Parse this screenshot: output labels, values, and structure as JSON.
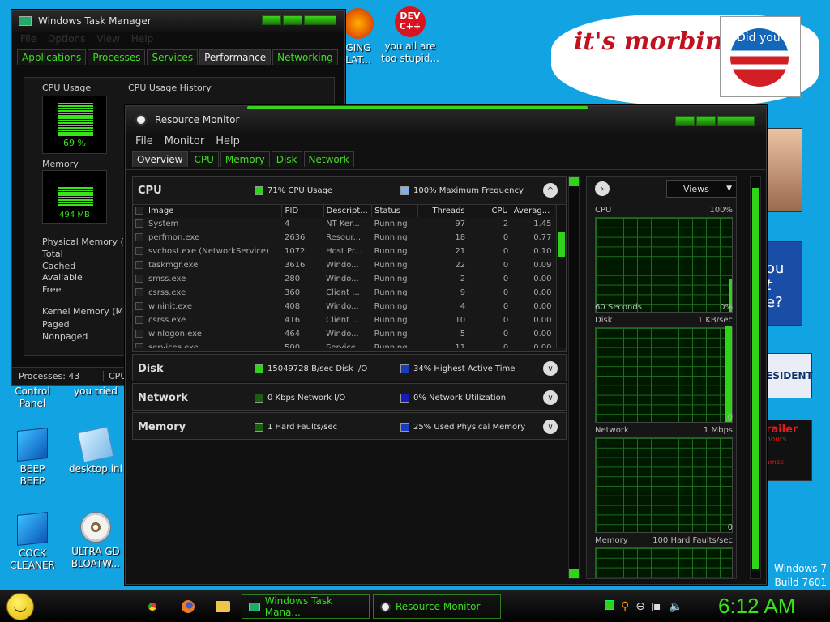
{
  "desktop": {
    "icons": [
      {
        "label": "GING\nLAT...",
        "icon": "folder-icon"
      },
      {
        "label": "you all are\ntoo stupid...",
        "icon": "devcpp-icon"
      },
      {
        "label": "Control\nPanel",
        "icon": "control-panel-icon"
      },
      {
        "label": "you tried",
        "icon": "file-icon"
      },
      {
        "label": "BEEP\nBEEP",
        "icon": "blue-box-icon"
      },
      {
        "label": "desktop.ini",
        "icon": "settings-file-icon"
      },
      {
        "label": "COCK\nCLEANER",
        "icon": "blue-box-icon"
      },
      {
        "label": "ULTRA GD\nBLOATW...",
        "icon": "disc-icon"
      }
    ],
    "dev_badge": "DEV\nC++",
    "banner_text": "it's morbin t",
    "obama_text": "Did you",
    "side_texts": [
      "ou",
      "t",
      "e?",
      "ESIDENT",
      "railer",
      "hours",
      "ames"
    ],
    "watermark": [
      "Windows 7",
      "Build 7601"
    ]
  },
  "task_manager": {
    "title": "Windows Task Manager",
    "menu": [
      "File",
      "Options",
      "View",
      "Help"
    ],
    "tabs": [
      "Applications",
      "Processes",
      "Services",
      "Performance",
      "Networking"
    ],
    "cpu_usage_label": "CPU Usage",
    "cpu_value": "69 %",
    "cpu_history_label": "CPU Usage History",
    "memory_label": "Memory",
    "memory_value": "494 MB",
    "physical_memory_label": "Physical Memory (MB",
    "physical_rows": [
      "Total",
      "Cached",
      "Available",
      "Free"
    ],
    "kernel_label": "Kernel Memory (MB)",
    "kernel_rows": [
      "Paged",
      "Nonpaged"
    ],
    "status_processes": "Processes: 43",
    "status_cpu": "CPU"
  },
  "resource_monitor": {
    "title": "Resource Monitor",
    "menu": [
      "File",
      "Monitor",
      "Help"
    ],
    "tabs": [
      "Overview",
      "CPU",
      "Memory",
      "Disk",
      "Network"
    ],
    "cpu_section": {
      "name": "CPU",
      "metric1": "71% CPU Usage",
      "metric2": "100% Maximum Frequency",
      "columns": [
        "Image",
        "PID",
        "Descript...",
        "Status",
        "Threads",
        "CPU",
        "Averag..."
      ],
      "rows": [
        [
          "System",
          "4",
          "NT Ker...",
          "Running",
          "97",
          "2",
          "1.45"
        ],
        [
          "perfmon.exe",
          "2636",
          "Resour...",
          "Running",
          "18",
          "0",
          "0.77"
        ],
        [
          "svchost.exe (NetworkService)",
          "1072",
          "Host Pr...",
          "Running",
          "21",
          "0",
          "0.10"
        ],
        [
          "taskmgr.exe",
          "3616",
          "Windo...",
          "Running",
          "22",
          "0",
          "0.09"
        ],
        [
          "smss.exe",
          "280",
          "Windo...",
          "Running",
          "2",
          "0",
          "0.00"
        ],
        [
          "csrss.exe",
          "360",
          "Client ...",
          "Running",
          "9",
          "0",
          "0.00"
        ],
        [
          "wininit.exe",
          "408",
          "Windo...",
          "Running",
          "4",
          "0",
          "0.00"
        ],
        [
          "csrss.exe",
          "416",
          "Client ...",
          "Running",
          "10",
          "0",
          "0.00"
        ],
        [
          "winlogon.exe",
          "464",
          "Windo...",
          "Running",
          "5",
          "0",
          "0.00"
        ],
        [
          "services.exe",
          "500",
          "Service...",
          "Running",
          "11",
          "0",
          "0.00"
        ]
      ]
    },
    "disk_section": {
      "name": "Disk",
      "metric1": "15049728 B/sec Disk I/O",
      "metric2": "34% Highest Active Time"
    },
    "network_section": {
      "name": "Network",
      "metric1": "0 Kbps Network I/O",
      "metric2": "0% Network Utilization"
    },
    "memory_section": {
      "name": "Memory",
      "metric1": "1 Hard Faults/sec",
      "metric2": "25% Used Physical Memory"
    },
    "views_label": "Views",
    "graphs": [
      {
        "name": "CPU",
        "max": "100%",
        "footer_left": "60 Seconds",
        "footer_right": "0%"
      },
      {
        "name": "Disk",
        "max": "1 KB/sec",
        "footer_left": "",
        "footer_right": "0"
      },
      {
        "name": "Network",
        "max": "1 Mbps",
        "footer_left": "",
        "footer_right": "0"
      },
      {
        "name": "Memory",
        "max": "100 Hard Faults/sec",
        "footer_left": "",
        "footer_right": ""
      }
    ]
  },
  "taskbar": {
    "buttons": [
      "Windows Task Mana...",
      "Resource Monitor"
    ],
    "clock": "6:12 AM"
  },
  "colors": {
    "accent": "#39d31b",
    "desktop": "#12a3e3",
    "window_bg": "#0d0d0d"
  }
}
